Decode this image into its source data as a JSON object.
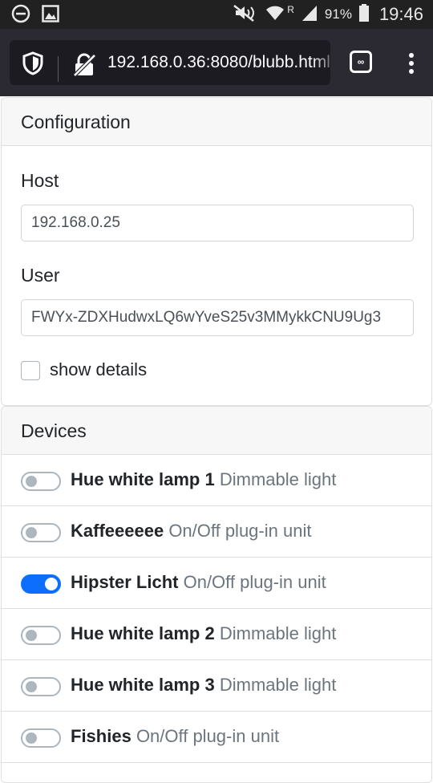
{
  "status_bar": {
    "battery": "91%",
    "time": "19:46",
    "roaming": "R",
    "icons": [
      "minus-circle-icon",
      "image-icon",
      "mute-icon",
      "wifi-icon",
      "signal-icon",
      "battery-icon"
    ]
  },
  "browser": {
    "url": "192.168.0.36:8080/blubb.html",
    "icons": [
      "shield-icon",
      "insecure-lock-icon",
      "tabs-icon",
      "menu-icon"
    ],
    "tabs_count": "∞"
  },
  "config": {
    "title": "Configuration",
    "host_label": "Host",
    "host_value": "192.168.0.25",
    "user_label": "User",
    "user_value": "FWYx-ZDXHudwxLQ6wYveS25v3MMykkCNU9Ug3",
    "show_details_label": "show details",
    "show_details_checked": false
  },
  "devices": {
    "title": "Devices",
    "items": [
      {
        "name": "Hue white lamp 1",
        "type": "Dimmable light",
        "on": false
      },
      {
        "name": "Kaffeeeeee",
        "type": "On/Off plug-in unit",
        "on": false
      },
      {
        "name": "Hipster Licht",
        "type": "On/Off plug-in unit",
        "on": true
      },
      {
        "name": "Hue white lamp 2",
        "type": "Dimmable light",
        "on": false
      },
      {
        "name": "Hue white lamp 3",
        "type": "Dimmable light",
        "on": false
      },
      {
        "name": "Fishies",
        "type": "On/Off plug-in unit",
        "on": false
      }
    ]
  },
  "colors": {
    "accent": "#0d6efd",
    "toolbar": "#2b2a33",
    "statusbar": "#212121"
  }
}
